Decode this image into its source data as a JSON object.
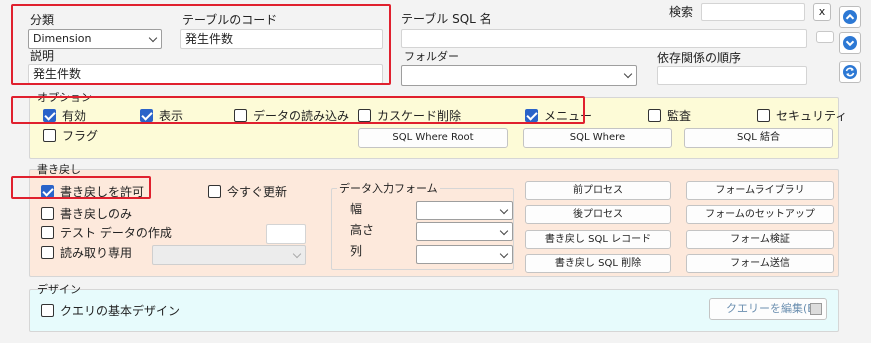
{
  "header": {
    "category_label": "分類",
    "category_value": "Dimension",
    "table_code_label": "テーブルのコード",
    "table_code_value": "発生件数",
    "table_sql_name_label": "テーブル SQL 名",
    "table_sql_name_value": "",
    "description_label": "説明",
    "description_value": "発生件数",
    "folder_label": "フォルダー",
    "folder_value": "",
    "search_label": "検索",
    "search_value": "",
    "search_clear": "x",
    "dependency_label": "依存関係の順序",
    "dependency_value": ""
  },
  "options": {
    "legend": "オプション",
    "valid": "有効",
    "display": "表示",
    "data_loading": "データの読み込み",
    "cascade_delete": "カスケード削除",
    "menu": "メニュー",
    "audit": "監査",
    "security": "セキュリティ",
    "flag": "フラグ",
    "sql_where_root": "SQL Where Root",
    "sql_where": "SQL Where",
    "sql_join": "SQL 結合"
  },
  "writeback": {
    "legend": "書き戻し",
    "allow": "書き戻しを許可",
    "update_now": "今すぐ更新",
    "only": "書き戻しのみ",
    "test_data": "テスト データの作成",
    "test_data_value": "",
    "read_only": "読み取り専用",
    "read_only_value": "",
    "form_legend": "データ入力フォーム",
    "width_label": "幅",
    "height_label": "高さ",
    "column_label": "列",
    "width_value": "",
    "height_value": "",
    "column_value": "",
    "pre_process": "前プロセス",
    "post_process": "後プロセス",
    "wb_sql_record": "書き戻し SQL レコード",
    "wb_sql_delete": "書き戻し SQL 削除",
    "form_library": "フォームライブラリ",
    "form_setup": "フォームのセットアップ",
    "form_validate": "フォーム検証",
    "form_send": "フォーム送信"
  },
  "design": {
    "legend": "デザイン",
    "query_basic_design": "クエリの基本デザイン",
    "edit_query": "クエリーを編集(E)"
  },
  "colors": {
    "options_bg": "#fdfbd7",
    "writeback_bg": "#fde9dc",
    "design_bg": "#e7fbfc",
    "highlight": "#e0202e",
    "checkbox_checked": "#2a63c9"
  }
}
